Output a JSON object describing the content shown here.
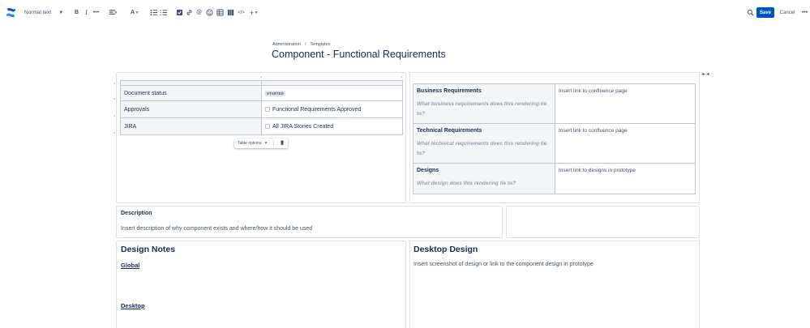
{
  "toolbar": {
    "logo_icon": "confluence-logo-icon",
    "text_style": "Normal text",
    "save_label": "Save",
    "cancel_label": "Cancel",
    "accent": "#0052cc"
  },
  "breadcrumb": {
    "items": [
      "Administration",
      "Templates"
    ],
    "separator": "/"
  },
  "page": {
    "title": "Component - Functional Requirements"
  },
  "status_table": {
    "rows": [
      {
        "label": "Document status",
        "value": "STARTED",
        "kind": "lozenge"
      },
      {
        "label": "Approvals",
        "value": "Functional Requirements Approved",
        "kind": "checkbox"
      },
      {
        "label": "JIRA",
        "value": "All JIRA Stories Created",
        "kind": "checkbox"
      }
    ],
    "options_label": "Table options"
  },
  "requirements_table": {
    "rows": [
      {
        "heading": "Business Requirements",
        "question": "What business requirements does this rendering tie to?",
        "value": "Insert link to confluence page"
      },
      {
        "heading": "Technical Requirements",
        "question": "What technical requirements does this rendering tie to?",
        "value": "Insert link to confluence page"
      },
      {
        "heading": "Designs",
        "question": "What design does this rendering tie to?",
        "value": "Insert link to designs in prototype"
      }
    ]
  },
  "description": {
    "heading": "Description",
    "text": "Insert description of why component exists and where/how it should be used"
  },
  "design_notes": {
    "heading": "Design Notes",
    "global_label": "Global",
    "desktop_label": "Desktop"
  },
  "desktop_design": {
    "heading": "Desktop Design",
    "text": "Insert screenshot of design or link to the component design in prototype"
  }
}
